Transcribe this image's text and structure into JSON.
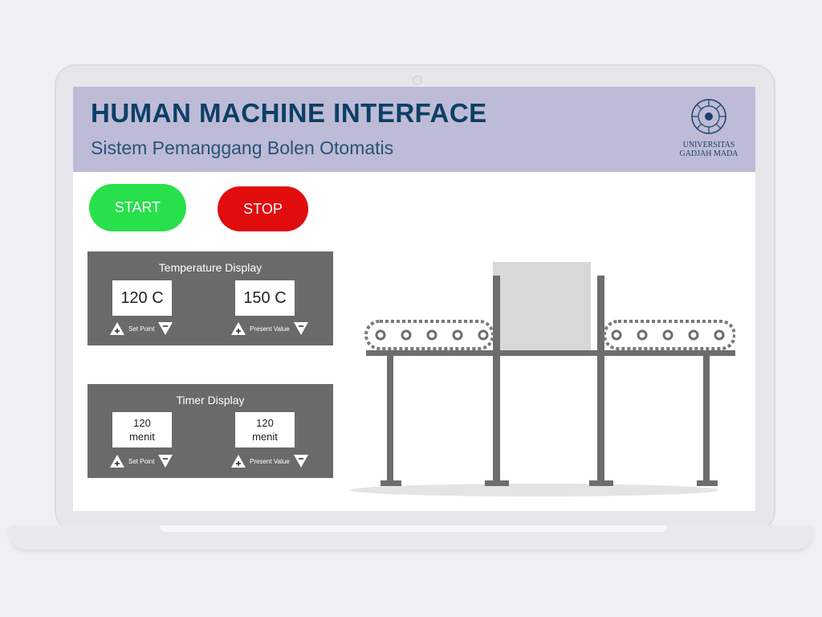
{
  "header": {
    "title": "HUMAN MACHINE INTERFACE",
    "subtitle": "Sistem Pemanggang Bolen Otomatis",
    "logo_line1": "UNIVERSITAS",
    "logo_line2": "GADJAH MADA"
  },
  "controls": {
    "start_label": "START",
    "stop_label": "STOP",
    "start_color": "#27e04a",
    "stop_color": "#e00c0e"
  },
  "temperature": {
    "title": "Temperature Display",
    "set_point_value": "120 C",
    "present_value": "150 C",
    "set_point_label": "Set Point",
    "present_value_label": "Present Value"
  },
  "timer": {
    "title": "Timer Display",
    "set_point_value": "120\nmenit",
    "present_value": "120\nmenit",
    "set_point_label": "Set Point",
    "present_value_label": "Present Value"
  },
  "colors": {
    "header_bg": "#bdbbd6",
    "title": "#0d3f66",
    "panel_bg": "#6a6a6a"
  }
}
